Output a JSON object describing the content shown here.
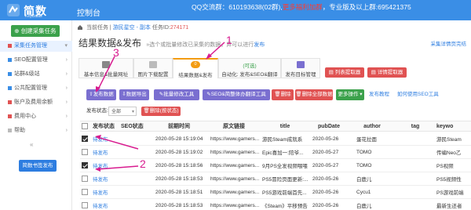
{
  "topbar": {
    "logo_text": "简数",
    "logo_sub": "KeyDatas",
    "console": "控制台",
    "qq_text": "QQ交流群：610193638(02群),",
    "qq_highlight": "更多福利加群",
    "qq_tail": "，专业版及以上群:695421375",
    "colors": {
      "bar": "#3a8ee6",
      "highlight": "#ff3b30"
    }
  },
  "sidebar": {
    "top_button": "创建采集任务",
    "items": [
      {
        "label": "采集任务管理",
        "state": "active"
      },
      {
        "label": "SEO配置管理",
        "state": "normal"
      },
      {
        "label": "站群&级站",
        "state": "normal"
      },
      {
        "label": "公共配置管理",
        "state": "normal"
      },
      {
        "label": "账户及费用余额",
        "state": "normal"
      },
      {
        "label": "费用中心",
        "state": "normal"
      },
      {
        "label": "帮助",
        "state": "normal"
      }
    ],
    "collapse": "«",
    "bottom_button": "简数书签发布"
  },
  "breadcrumb": {
    "home": "当前任务",
    "sep": "|",
    "task": "游民星空 - 副本",
    "task_id_label": "任务ID:",
    "task_id": "274171"
  },
  "headline": {
    "title": "结果数据&发布",
    "sub_before": "»选个或批量修改已采集的数据，并可以进行",
    "sub_link": "发布",
    "pub_link": "采集详情页完结"
  },
  "tabs": [
    {
      "label": "基本信息&批量网址",
      "icon": "doc-icon"
    },
    {
      "label": "图片下载配置",
      "icon": "image-icon"
    },
    {
      "label": "结果数据&发布",
      "badge": "0",
      "active": true
    },
    {
      "label": "自动化: 发布&SEO&翻译",
      "top_text": "(可选)"
    },
    {
      "label": "发布目标管理",
      "icon": "target-icon"
    }
  ],
  "tab_buttons": {
    "list_extractor": "列表提取器",
    "detail_extractor": "详情提取器"
  },
  "toolbar": {
    "publish": "发布数据",
    "export": "数据导出",
    "batch_edit": "批量修改工具",
    "seo_translate": "SEO&简整体办翻译工具",
    "delete": "删除",
    "delete_all": "删除全部数据",
    "more": "更多操作 ▾",
    "publish_tutorial": "发布教程",
    "seo_tool": "如何使用SEO工具"
  },
  "filter": {
    "label": "发布状态:",
    "selected": "全部",
    "delete_by_status": "删除(按状态)"
  },
  "table": {
    "columns": [
      "发布状态",
      "SEO状态",
      "前期时间",
      "原文链接",
      "title",
      "pubDate",
      "author",
      "tag",
      "keywo"
    ],
    "rows": [
      {
        "checked": true,
        "status": "待发布",
        "seo": "",
        "time": "2020-05-28 15:19:04",
        "link": "https://www.gamers...",
        "title": "游民Steam成就系",
        "pubDate": "2020-05-26",
        "author": "蛋花拉面",
        "tag": "",
        "keyword": "游民Steam"
      },
      {
        "checked": false,
        "status": "待发布",
        "seo": "",
        "time": "2020-05-28 15:19:02",
        "link": "https://www.gamers...",
        "title": "Epic喜加一:陪爷...",
        "pubDate": "2020-05-27",
        "author": "TOMO",
        "tag": "",
        "keyword": "传编Neo乙"
      },
      {
        "checked": true,
        "status": "待发布",
        "seo": "",
        "time": "2020-05-28 15:18:56",
        "link": "https://www.gamers...",
        "title": "9月PS全发视频喂喂",
        "pubDate": "2020-05-27",
        "author": "TOMO",
        "tag": "",
        "keyword": "PS视频"
      },
      {
        "checked": false,
        "status": "待发布",
        "seo": "",
        "time": "2020-05-28 15:18:53",
        "link": "https://www.gamers...",
        "title": "PS5冒险页面更新:...",
        "pubDate": "2020-05-26",
        "author": "白鹿儿",
        "tag": "",
        "keyword": "PS5视频性"
      },
      {
        "checked": false,
        "status": "待发布",
        "seo": "",
        "time": "2020-05-28 15:18:51",
        "link": "https://www.gamers...",
        "title": "PS5游戏前端首先...",
        "pubDate": "2020-05-26",
        "author": "Cycu1",
        "tag": "",
        "keyword": "PS游戏前端"
      },
      {
        "checked": false,
        "status": "待发布",
        "seo": "",
        "time": "2020-05-28 15:18:53",
        "link": "https://www.gamers...",
        "title": "《Steam》平移预告",
        "pubDate": "2020-05-26",
        "author": "白鹿儿",
        "tag": "",
        "keyword": "最新生还者"
      }
    ]
  },
  "annotations": {
    "one": "1",
    "two": "2",
    "three": "3",
    "color": "#d81b8f"
  }
}
